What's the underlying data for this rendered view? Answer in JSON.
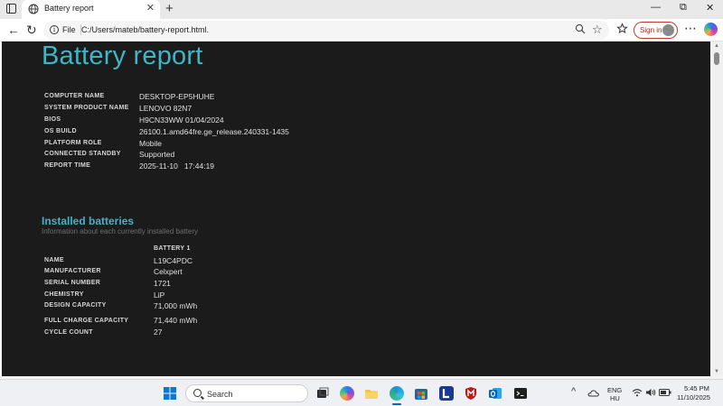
{
  "browser": {
    "tab_title": "Battery report",
    "tab_close": "✕",
    "new_tab": "+",
    "window_controls": {
      "minimize": "—",
      "maximize": "⧉",
      "close": "✕"
    },
    "back": "←",
    "refresh": "↻",
    "address_scheme": "File",
    "url": "C:/Users/mateb/battery-report.html.",
    "signin_label": "Sign in"
  },
  "report": {
    "title": "Battery report",
    "system_info": [
      {
        "label": "COMPUTER NAME",
        "value": "DESKTOP-EP5HUHE"
      },
      {
        "label": "SYSTEM PRODUCT NAME",
        "value": "LENOVO 82N7"
      },
      {
        "label": "BIOS",
        "value": "H9CN33WW 01/04/2024"
      },
      {
        "label": "OS BUILD",
        "value": "26100.1.amd64fre.ge_release.240331-1435"
      },
      {
        "label": "PLATFORM ROLE",
        "value": "Mobile"
      },
      {
        "label": "CONNECTED STANDBY",
        "value": "Supported"
      },
      {
        "label": "REPORT TIME",
        "value": "2025-11-10   17:44:19"
      }
    ],
    "installed_batteries": {
      "title": "Installed batteries",
      "subtitle": "Information about each currently installed battery",
      "column_header": "BATTERY 1",
      "rows": [
        {
          "label": "NAME",
          "value": "L19C4PDC"
        },
        {
          "label": "MANUFACTURER",
          "value": "Celxpert"
        },
        {
          "label": "SERIAL NUMBER",
          "value": "1721"
        },
        {
          "label": "CHEMISTRY",
          "value": "LiP"
        },
        {
          "label": "DESIGN CAPACITY",
          "value": "71,000 mWh"
        },
        {
          "label": "FULL CHARGE CAPACITY",
          "value": "71,440 mWh"
        },
        {
          "label": "CYCLE COUNT",
          "value": "27"
        }
      ]
    }
  },
  "taskbar": {
    "search_placeholder": "Search",
    "language": "ENG",
    "region": "HU",
    "time": "5:45 PM",
    "date": "11/10/2025",
    "overflow": "^",
    "icons": [
      "windows-start",
      "task-view",
      "copilot",
      "file-explorer",
      "edge",
      "microsoft-store",
      "lenovo-vantage",
      "mcafee",
      "outlook",
      "terminal"
    ]
  },
  "colors": {
    "report_bg": "#1b1b1b",
    "accent_title": "#3fb5c6",
    "label_text": "#d7d7d7",
    "value_text": "#e0e0e0",
    "signin_red": "#b3261e"
  }
}
